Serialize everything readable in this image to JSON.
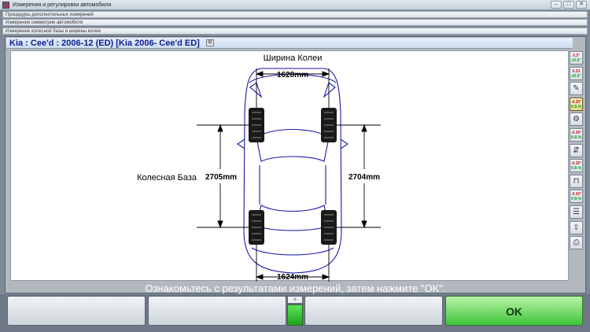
{
  "window": {
    "title": "Измерения и регулировки автомобиля",
    "min_label": "–",
    "max_label": "□",
    "close_label": "✕"
  },
  "nav": {
    "strip1": "Процедуры дополнительных измерений",
    "strip2": "Измерения симметрии автомобиля",
    "strip3": "Измерение колесной базы и ширины колеи"
  },
  "vehicle": {
    "title": "Kia : Cee'd : 2006-12 (ED) [Kia 2006- Cee'd ED]",
    "note_glyph": "▤"
  },
  "diagram": {
    "track_heading": "Ширина Колеи",
    "front_track": "1628mm",
    "rear_track": "1624mm",
    "wheelbase_label": "Колесная База",
    "left_wheelbase": "2705mm",
    "right_wheelbase": "2704mm",
    "line_color": "#1a1aa8"
  },
  "sidebar": {
    "tools": [
      {
        "name": "camber-tool",
        "l1": "0.3°",
        "l2": "±0.5°"
      },
      {
        "name": "toe-tool",
        "l1": "0.33",
        "l2": "±0.5°"
      },
      {
        "name": "pencil-tool",
        "glyph": "✎"
      },
      {
        "name": "camber-range-tool",
        "l1": "-0.30°",
        "l2": "0-8-%"
      },
      {
        "name": "wrench-tool",
        "glyph": "⚙"
      },
      {
        "name": "gauge-tool",
        "l1": "-0.30°",
        "l2": "0-8-%"
      },
      {
        "name": "adjust-tool",
        "glyph": "⇵"
      },
      {
        "name": "offset-tool",
        "l1": "-0.30°",
        "l2": "0-8-%"
      },
      {
        "name": "clamp-tool",
        "glyph": "⊓"
      },
      {
        "name": "caster-tool",
        "l1": "-0.30°",
        "l2": "0-8-%"
      },
      {
        "name": "list-tool",
        "glyph": "☰"
      },
      {
        "name": "lift-tool",
        "glyph": "⇪"
      },
      {
        "name": "print-tool",
        "glyph": "⎙"
      }
    ]
  },
  "status": {
    "message": "Ознакомьтесь с результатами измерений, затем нажмите \"OK\"."
  },
  "footer": {
    "f1": "",
    "f2": "",
    "f3": "",
    "ok_label": "OK",
    "indicator_label": "◦1◦"
  }
}
